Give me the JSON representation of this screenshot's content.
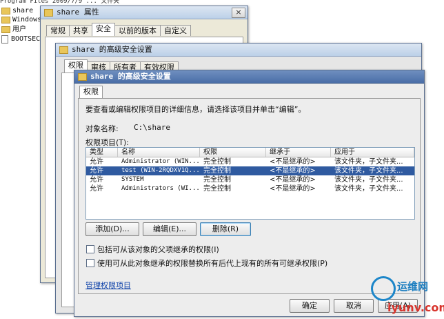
{
  "explorer": {
    "top_row": "Program Files   2009/7/9 ... 文件夹",
    "items": [
      "share",
      "Windows",
      "用户",
      "BOOTSECT..."
    ]
  },
  "properties_dialog": {
    "title": "share 属性",
    "tabs": [
      "常规",
      "共享",
      "安全",
      "以前的版本",
      "自定义"
    ],
    "selected_tab": "安全",
    "close": "×"
  },
  "advanced_back": {
    "title": "share 的高级安全设置",
    "tabs": [
      "权限",
      "审核",
      "所有者",
      "有效权限"
    ]
  },
  "advanced": {
    "title": "share 的高级安全设置",
    "tab": "权限",
    "description": "要查看或编辑权限项目的详细信息，请选择该项目并单击“编辑”。",
    "object_name_label": "对象名称:",
    "object_name_value": "C:\\share",
    "entries_label": "权限项目(T):",
    "columns": [
      "类型",
      "名称",
      "权限",
      "继承于",
      "应用于"
    ],
    "rows": [
      {
        "type": "允许",
        "name": "Administrator (WIN...",
        "perm": "完全控制",
        "inherit": "<不是继承的>",
        "apply": "该文件夹，子文件夹..."
      },
      {
        "type": "允许",
        "name": "test (WIN-2RQDXV1Q...",
        "perm": "完全控制",
        "inherit": "<不是继承的>",
        "apply": "该文件夹，子文件夹...",
        "selected": true
      },
      {
        "type": "允许",
        "name": "SYSTEM",
        "perm": "完全控制",
        "inherit": "<不是继承的>",
        "apply": "该文件夹，子文件夹..."
      },
      {
        "type": "允许",
        "name": "Administrators (WI...",
        "perm": "完全控制",
        "inherit": "<不是继承的>",
        "apply": "该文件夹，子文件夹..."
      }
    ],
    "buttons": {
      "add": "添加(D)...",
      "edit": "编辑(E)...",
      "remove": "删除(R)"
    },
    "checkbox1": "包括可从该对象的父项继承的权限(I)",
    "checkbox2": "使用可从此对象继承的权限替换所有后代上现有的所有可继承权限(P)",
    "manage_link": "管理权限项目",
    "ok": "确定",
    "cancel": "取消",
    "apply": "应用(A)"
  },
  "watermark": {
    "line1": "运维网",
    "line2": "iyunv.com"
  }
}
